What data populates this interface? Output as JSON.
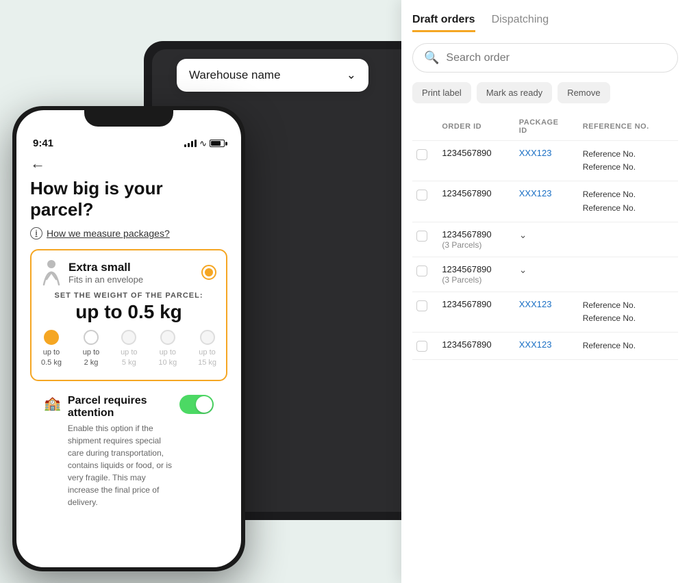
{
  "background": "#e8f0ed",
  "darkTablet": {
    "warehouseDropdown": {
      "label": "Warehouse name",
      "chevron": "⌄"
    }
  },
  "rightPanel": {
    "tabs": [
      {
        "label": "Draft orders",
        "active": true
      },
      {
        "label": "Dispatching",
        "active": false
      }
    ],
    "search": {
      "placeholder": "Search order"
    },
    "actionButtons": [
      {
        "label": "Print label"
      },
      {
        "label": "Mark as ready"
      },
      {
        "label": "Remove"
      }
    ],
    "table": {
      "headers": [
        "",
        "ORDER ID",
        "PACKAGE ID",
        "REFERENCE NO."
      ],
      "rows": [
        {
          "orderId": "1234567890",
          "packageId": "XXX123",
          "referenceNo": "Reference No.\nReference No.",
          "expanded": false
        },
        {
          "orderId": "1234567890",
          "packageId": "XXX123",
          "referenceNo": "Reference No.\nReference No.",
          "expanded": false
        },
        {
          "orderId": "1234567890",
          "orderSub": "(3 Parcels)",
          "packageId": "",
          "referenceNo": "",
          "expanded": true
        },
        {
          "orderId": "1234567890",
          "orderSub": "(3 Parcels)",
          "packageId": "",
          "referenceNo": "",
          "expanded": true
        },
        {
          "orderId": "1234567890",
          "packageId": "XXX123",
          "referenceNo": "Reference No.\nReference No.",
          "expanded": false
        },
        {
          "orderId": "1234567890",
          "packageId": "XXX123",
          "referenceNo": "Reference No.",
          "expanded": false
        }
      ]
    }
  },
  "phone": {
    "statusBar": {
      "time": "9:41"
    },
    "backLabel": "←",
    "pageTitle": "How big is your parcel?",
    "infoLink": "How we measure packages?",
    "packageCard": {
      "name": "Extra small",
      "desc": "Fits in an envelope",
      "weightLabel": "SET THE WEIGHT OF THE PARCEL:",
      "weightValue": "up to 0.5 kg",
      "weightOptions": [
        {
          "label": "up to\n0.5 kg",
          "selected": true
        },
        {
          "label": "up to\n2 kg",
          "selected": false
        },
        {
          "label": "up to\n5 kg",
          "selected": false,
          "disabled": true
        },
        {
          "label": "up to\n10 kg",
          "selected": false,
          "disabled": true
        },
        {
          "label": "up to\n15 kg",
          "selected": false,
          "disabled": true
        }
      ]
    },
    "attention": {
      "title": "Parcel requires attention",
      "desc": "Enable this option if the shipment requires special care during transportation, contains liquids or food, or is very fragile. This may increase the final price of delivery.",
      "toggleOn": true
    }
  }
}
